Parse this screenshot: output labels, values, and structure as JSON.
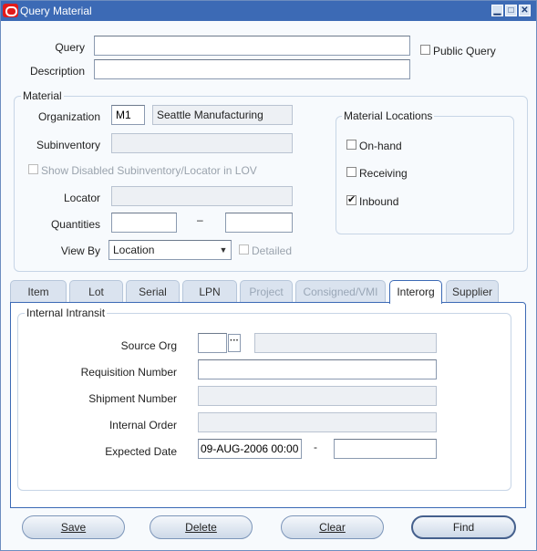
{
  "window": {
    "title": "Query Material",
    "minimize": "▁",
    "maximize": "□",
    "close": "✕"
  },
  "query": {
    "query_label": "Query",
    "query_value": "",
    "description_label": "Description",
    "description_value": "",
    "public_query_label": "Public Query",
    "public_query_checked": false
  },
  "material": {
    "group_title": "Material",
    "organization_label": "Organization",
    "organization_code": "M1",
    "organization_name": "Seattle Manufacturing",
    "subinventory_label": "Subinventory",
    "subinventory_value": "",
    "show_disabled_label": "Show Disabled Subinventory/Locator in LOV",
    "show_disabled_checked": false,
    "locator_label": "Locator",
    "locator_value": "",
    "quantities_label": "Quantities",
    "quantity_from": "",
    "quantity_dash": "–",
    "quantity_to": "",
    "view_by_label": "View By",
    "view_by_value": "Location",
    "detailed_label": "Detailed",
    "detailed_checked": false
  },
  "material_locations": {
    "group_title": "Material Locations",
    "on_hand_label": "On-hand",
    "on_hand_checked": false,
    "receiving_label": "Receiving",
    "receiving_checked": false,
    "inbound_label": "Inbound",
    "inbound_checked": true
  },
  "tabs": [
    {
      "label": "Item",
      "state": "normal"
    },
    {
      "label": "Lot",
      "state": "normal"
    },
    {
      "label": "Serial",
      "state": "normal"
    },
    {
      "label": "LPN",
      "state": "normal"
    },
    {
      "label": "Project",
      "state": "disabled"
    },
    {
      "label": "Consigned/VMI",
      "state": "disabled"
    },
    {
      "label": "Interorg",
      "state": "active"
    },
    {
      "label": "Supplier",
      "state": "normal"
    }
  ],
  "intransit": {
    "group_title": "Internal Intransit",
    "source_org_label": "Source Org",
    "source_org_value": "",
    "source_org_name": "",
    "requisition_label": "Requisition Number",
    "requisition_value": "",
    "shipment_label": "Shipment Number",
    "shipment_value": "",
    "internal_order_label": "Internal Order",
    "internal_order_value": "",
    "expected_date_label": "Expected Date",
    "expected_date_from": "09-AUG-2006 00:00",
    "expected_date_dash": "-",
    "expected_date_to": ""
  },
  "buttons": {
    "save": "Save",
    "delete": "Delete",
    "clear": "Clear",
    "find": "Find"
  },
  "colors": {
    "titlebar": "#3c6ab5",
    "background": "#f7fafd",
    "accent": "#3c6ab5"
  },
  "icons": {
    "app": "oracle-icon",
    "lov": "ellipsis-icon",
    "dropdown": "chevron-down-icon"
  }
}
